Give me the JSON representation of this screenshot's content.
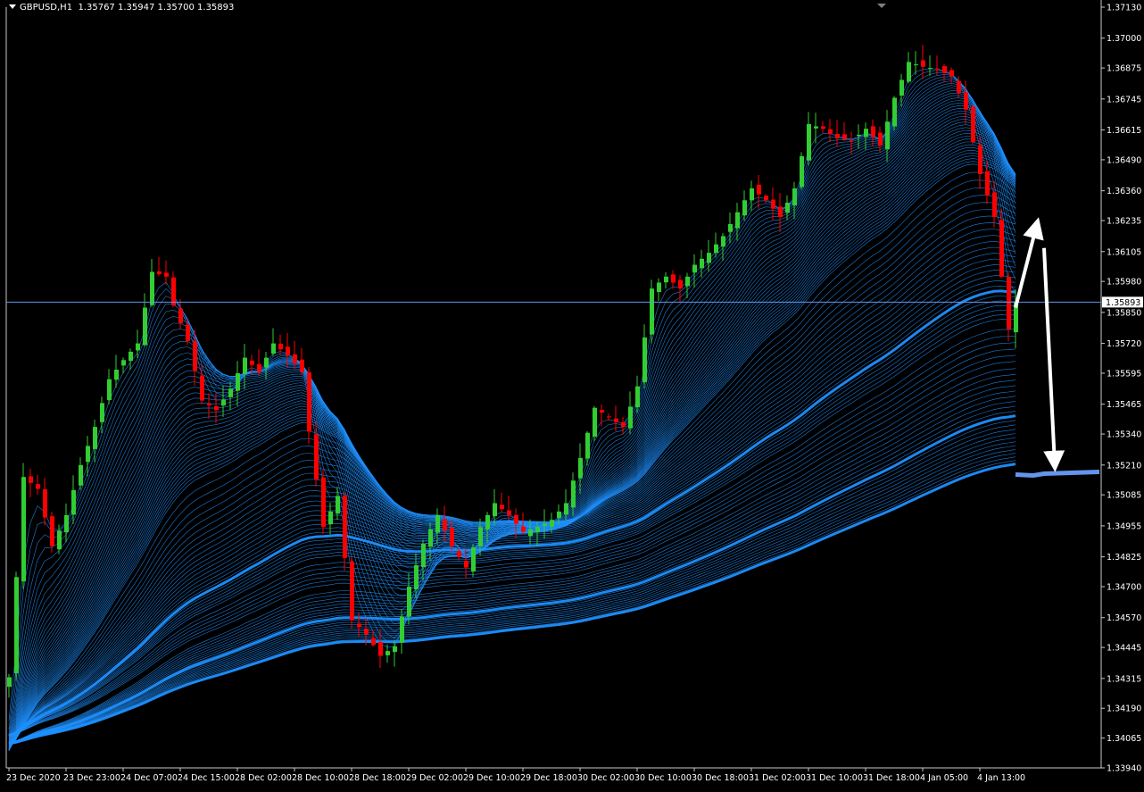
{
  "header": {
    "symbol": "GBPUSD,H1",
    "ohlc": "1.35767 1.35947 1.35700 1.35893"
  },
  "chart_data": {
    "type": "candlestick",
    "symbol": "GBPUSD",
    "timeframe": "H1",
    "background": "#000000",
    "colors": {
      "bull": "#32CD32",
      "bear": "#FF0000",
      "ribbon": "#1E90FF",
      "ribbon_light": "#6495ED",
      "current_price_line": "#6495ED",
      "arrows": "#FFFFFF"
    },
    "current_price": 1.35893,
    "ylim": [
      1.3394,
      1.3713
    ],
    "y_ticks": [
      1.3713,
      1.37,
      1.36875,
      1.36745,
      1.36615,
      1.3649,
      1.3636,
      1.36235,
      1.36105,
      1.3598,
      1.3585,
      1.3572,
      1.35595,
      1.35465,
      1.3534,
      1.3521,
      1.35085,
      1.34955,
      1.34825,
      1.347,
      1.3457,
      1.34445,
      1.34315,
      1.3419,
      1.34065,
      1.3394
    ],
    "y_tick_labels": [
      "1.37130",
      "1.37000",
      "1.36875",
      "1.36745",
      "1.36615",
      "1.36490",
      "1.36360",
      "1.36235",
      "1.36105",
      "1.35980",
      "1.35850",
      "1.35720",
      "1.35595",
      "1.35465",
      "1.35340",
      "1.35210",
      "1.35085",
      "1.34955",
      "1.34825",
      "1.34700",
      "1.34570",
      "1.34445",
      "1.34315",
      "1.34190",
      "1.34065",
      "1.33940"
    ],
    "x_labels": [
      {
        "label": "23 Dec 2020",
        "bar": 0
      },
      {
        "label": "23 Dec 23:00",
        "bar": 8
      },
      {
        "label": "24 Dec 07:00",
        "bar": 16
      },
      {
        "label": "24 Dec 15:00",
        "bar": 24
      },
      {
        "label": "28 Dec 02:00",
        "bar": 32
      },
      {
        "label": "28 Dec 10:00",
        "bar": 40
      },
      {
        "label": "28 Dec 18:00",
        "bar": 48
      },
      {
        "label": "29 Dec 02:00",
        "bar": 56
      },
      {
        "label": "29 Dec 10:00",
        "bar": 64
      },
      {
        "label": "29 Dec 18:00",
        "bar": 72
      },
      {
        "label": "30 Dec 02:00",
        "bar": 80
      },
      {
        "label": "30 Dec 10:00",
        "bar": 88
      },
      {
        "label": "30 Dec 18:00",
        "bar": 96
      },
      {
        "label": "31 Dec 02:00",
        "bar": 104
      },
      {
        "label": "31 Dec 10:00",
        "bar": 112
      },
      {
        "label": "31 Dec 18:00",
        "bar": 120
      },
      {
        "label": "4 Jan 05:00",
        "bar": 128
      },
      {
        "label": "4 Jan 13:00",
        "bar": 136
      }
    ],
    "close_path": [
      [
        0,
        1.3432
      ],
      [
        2,
        1.3516
      ],
      [
        4,
        1.3511
      ],
      [
        6,
        1.3487
      ],
      [
        8,
        1.35
      ],
      [
        10,
        1.3521
      ],
      [
        12,
        1.3537
      ],
      [
        14,
        1.3557
      ],
      [
        16,
        1.3565
      ],
      [
        18,
        1.3572
      ],
      [
        20,
        1.3602
      ],
      [
        22,
        1.36
      ],
      [
        23,
        1.3588
      ],
      [
        25,
        1.3573
      ],
      [
        27,
        1.3548
      ],
      [
        29,
        1.3544
      ],
      [
        31,
        1.3553
      ],
      [
        33,
        1.3566
      ],
      [
        35,
        1.356
      ],
      [
        37,
        1.3572
      ],
      [
        39,
        1.3567
      ],
      [
        41,
        1.356
      ],
      [
        42,
        1.3535
      ],
      [
        44,
        1.3495
      ],
      [
        46,
        1.3508
      ],
      [
        48,
        1.3456
      ],
      [
        50,
        1.345
      ],
      [
        52,
        1.3441
      ],
      [
        54,
        1.3445
      ],
      [
        56,
        1.347
      ],
      [
        58,
        1.3488
      ],
      [
        60,
        1.35
      ],
      [
        62,
        1.3487
      ],
      [
        64,
        1.3478
      ],
      [
        66,
        1.3495
      ],
      [
        68,
        1.3505
      ],
      [
        70,
        1.35
      ],
      [
        72,
        1.3493
      ],
      [
        74,
        1.3495
      ],
      [
        76,
        1.3498
      ],
      [
        78,
        1.3505
      ],
      [
        80,
        1.3524
      ],
      [
        82,
        1.3545
      ],
      [
        84,
        1.3541
      ],
      [
        86,
        1.3537
      ],
      [
        88,
        1.3554
      ],
      [
        90,
        1.3595
      ],
      [
        92,
        1.36
      ],
      [
        94,
        1.3595
      ],
      [
        96,
        1.3605
      ],
      [
        98,
        1.361
      ],
      [
        100,
        1.3617
      ],
      [
        102,
        1.3627
      ],
      [
        104,
        1.3637
      ],
      [
        106,
        1.3632
      ],
      [
        108,
        1.3625
      ],
      [
        110,
        1.3637
      ],
      [
        112,
        1.3664
      ],
      [
        114,
        1.3662
      ],
      [
        116,
        1.3658
      ],
      [
        118,
        1.3657
      ],
      [
        120,
        1.3662
      ],
      [
        122,
        1.3655
      ],
      [
        124,
        1.3675
      ],
      [
        126,
        1.369
      ],
      [
        128,
        1.3688
      ],
      [
        130,
        1.3687
      ],
      [
        132,
        1.3684
      ],
      [
        134,
        1.367
      ],
      [
        136,
        1.3643
      ],
      [
        138,
        1.3625
      ],
      [
        139,
        1.36
      ],
      [
        140,
        1.3578
      ],
      [
        141,
        1.35893
      ]
    ],
    "projection_arrows": [
      {
        "from": [
          1.3587,
          141
        ],
        "to": [
          1.3622,
          144
        ]
      },
      {
        "from": [
          1.3612,
          145
        ],
        "to": [
          1.3521,
          146.5
        ]
      }
    ],
    "projection_level": 1.3517
  }
}
